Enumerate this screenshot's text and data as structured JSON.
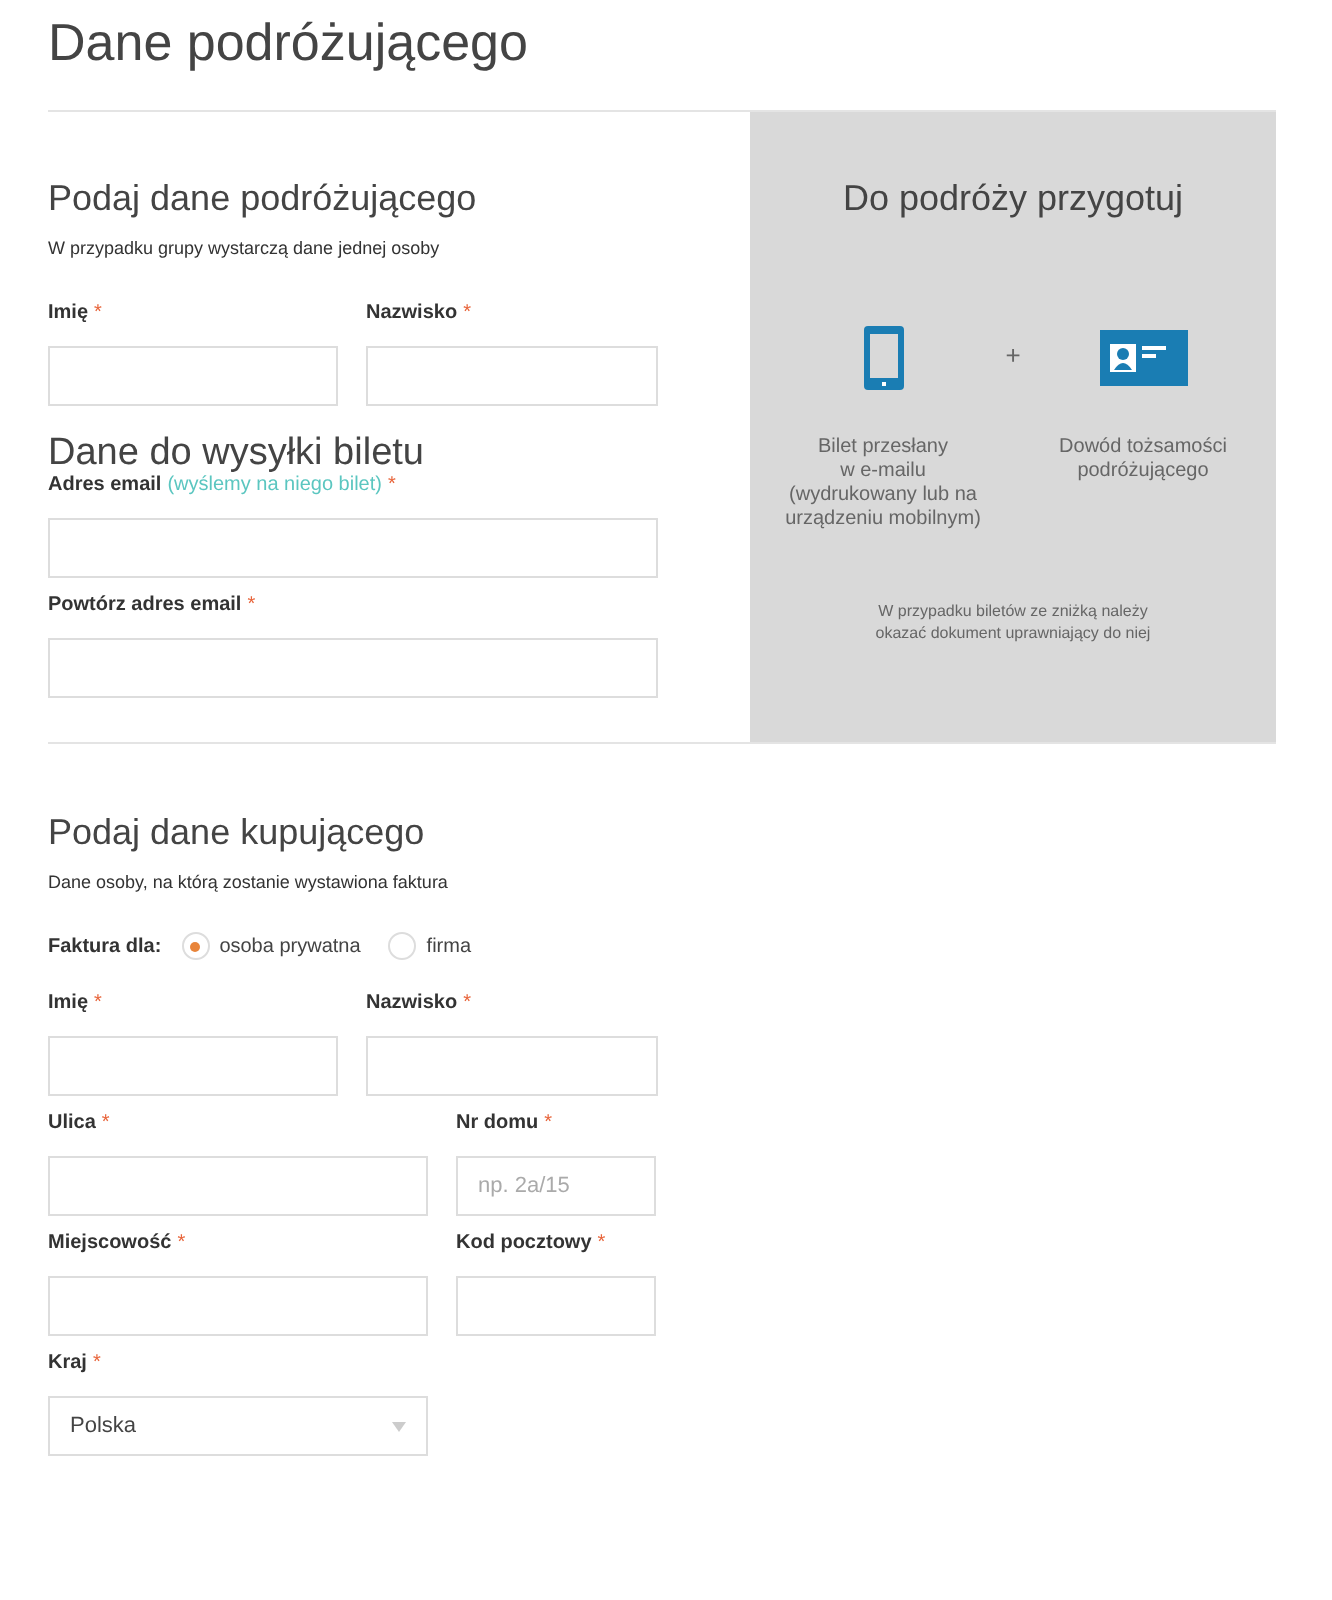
{
  "page_title": "Dane podróżującego",
  "traveler": {
    "heading": "Podaj dane podróżującego",
    "subtitle": "W przypadku grupy wystarczą dane jednej osoby",
    "rows": [
      [
        {
          "label": "Imię",
          "mark": "*"
        },
        {
          "label": "Nazwisko",
          "mark": "*"
        }
      ]
    ]
  },
  "shipping": {
    "heading": "Dane do wysyłki biletu",
    "rows": [
      [
        {
          "label": "Adres email",
          "note": "(wyślemy na niego bilet)",
          "mark": "*"
        }
      ],
      [
        {
          "label": "Powtórz adres email",
          "mark": "*"
        }
      ]
    ]
  },
  "info_panel": {
    "heading": "Do podróży przygotuj",
    "plus": "+",
    "items": [
      {
        "kind": "phone",
        "caption": "Bilet przesłany\nw e-mailu\n(wydrukowany lub na\nurządzeniu mobilnym)"
      },
      {
        "kind": "id-card",
        "caption": "Dowód tożsamości\npodróżującego"
      }
    ],
    "note": "W przypadku biletów ze zniżką należy\nokazać dokument uprawniający do niej"
  },
  "buyer": {
    "heading": "Podaj dane kupującego",
    "subtitle": "Dane osoby, na którą zostanie wystawiona faktura",
    "invoice_for": {
      "label": "Faktura dla:",
      "options": [
        {
          "label": "osoba prywatna",
          "selected": true
        },
        {
          "label": "firma",
          "selected": false
        }
      ]
    },
    "rows": [
      [
        {
          "label": "Imię",
          "mark": "*"
        },
        {
          "label": "Nazwisko",
          "mark": "*"
        }
      ],
      [
        {
          "label": "Ulica",
          "mark": "*"
        },
        {
          "label": "Nr domu",
          "mark": "*",
          "placeholder": "np. 2a/15"
        }
      ],
      [
        {
          "label": "Miejscowość",
          "mark": "*"
        },
        {
          "label": "Kod pocztowy",
          "mark": "*"
        }
      ],
      [
        {
          "label": "Kraj",
          "mark": "*",
          "kind": "select",
          "value": "Polska"
        }
      ]
    ]
  }
}
